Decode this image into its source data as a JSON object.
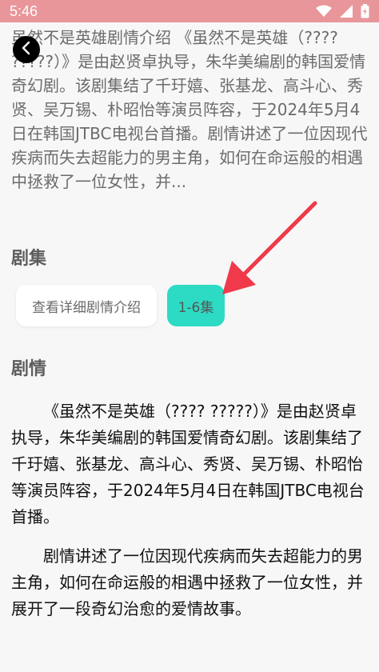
{
  "status_bar": {
    "time": "5:46",
    "icons": [
      "wifi-icon",
      "cellular-signal-icon",
      "battery-icon"
    ]
  },
  "colors": {
    "status_bar_bg": "#e8969a",
    "episode_button_bg": "#2ddbc4",
    "arrow_color": "#f0394a"
  },
  "intro": {
    "summary": "虽然不是英雄剧情介绍 《虽然不是英雄（???? ?????）》是由赵贤卓执导，朱华美编剧的韩国爱情奇幻剧。该剧集结了千玗嬉、张基龙、高斗心、秀贤、吴万锡、朴昭怡等演员阵容，于2024年5月4日在韩国JTBC电视台首播。剧情讲述了一位因现代疾病而失去超能力的男主角，如何在命运般的相遇中拯救了一位女性，并..."
  },
  "episodes": {
    "title": "剧集",
    "detail_button": "查看详细剧情介绍",
    "range_button": "1-6集"
  },
  "plot": {
    "title": "剧情",
    "paragraphs": [
      "《虽然不是英雄（???? ?????）》是由赵贤卓执导，朱华美编剧的韩国爱情奇幻剧。该剧集结了千玗嬉、张基龙、高斗心、秀贤、吴万锡、朴昭怡等演员阵容，于2024年5月4日在韩国JTBC电视台首播。",
      "剧情讲述了一位因现代疾病而失去超能力的男主角，如何在命运般的相遇中拯救了一位女性，并展开了一段奇幻治愈的爱情故事。"
    ]
  }
}
